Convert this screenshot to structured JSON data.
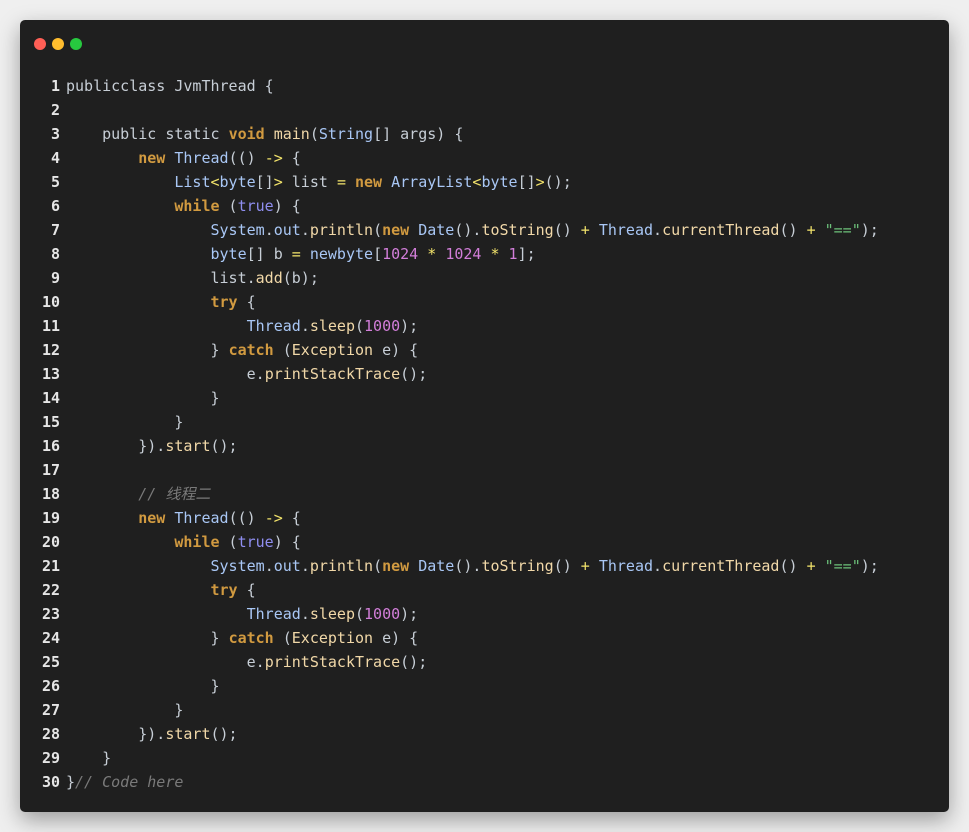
{
  "window": {
    "traffic_lights": [
      {
        "name": "close",
        "color": "#ff5f56"
      },
      {
        "name": "minimize",
        "color": "#ffbd2e"
      },
      {
        "name": "zoom",
        "color": "#27c93f"
      }
    ]
  },
  "code_lines": [
    {
      "n": "1",
      "tokens": [
        [
          "t-pl",
          "publicclass "
        ],
        [
          "t-pl",
          "JvmThread"
        ],
        [
          "t-pl",
          " {"
        ]
      ]
    },
    {
      "n": "2",
      "tokens": []
    },
    {
      "n": "3",
      "tokens": [
        [
          "t-pl",
          "    public static "
        ],
        [
          "t-kw",
          "void"
        ],
        [
          "t-pl",
          " "
        ],
        [
          "t-mth",
          "main"
        ],
        [
          "t-pl",
          "("
        ],
        [
          "t-cls",
          "String"
        ],
        [
          "t-pl",
          "[] args) {"
        ]
      ]
    },
    {
      "n": "4",
      "tokens": [
        [
          "t-pl",
          "        "
        ],
        [
          "t-kw",
          "new"
        ],
        [
          "t-pl",
          " "
        ],
        [
          "t-cls",
          "Thread"
        ],
        [
          "t-pl",
          "(() "
        ],
        [
          "t-op",
          "->"
        ],
        [
          "t-pl",
          " {"
        ]
      ]
    },
    {
      "n": "5",
      "tokens": [
        [
          "t-pl",
          "            "
        ],
        [
          "t-cls",
          "List"
        ],
        [
          "t-op",
          "<"
        ],
        [
          "t-cls",
          "byte"
        ],
        [
          "t-pl",
          "[]"
        ],
        [
          "t-op",
          ">"
        ],
        [
          "t-pl",
          " list "
        ],
        [
          "t-op",
          "="
        ],
        [
          "t-pl",
          " "
        ],
        [
          "t-kw",
          "new"
        ],
        [
          "t-pl",
          " "
        ],
        [
          "t-cls",
          "ArrayList"
        ],
        [
          "t-op",
          "<"
        ],
        [
          "t-cls",
          "byte"
        ],
        [
          "t-pl",
          "[]"
        ],
        [
          "t-op",
          ">"
        ],
        [
          "t-pl",
          "();"
        ]
      ]
    },
    {
      "n": "6",
      "tokens": [
        [
          "t-pl",
          "            "
        ],
        [
          "t-kw",
          "while"
        ],
        [
          "t-pl",
          " ("
        ],
        [
          "t-bool",
          "true"
        ],
        [
          "t-pl",
          ") {"
        ]
      ]
    },
    {
      "n": "7",
      "tokens": [
        [
          "t-pl",
          "                "
        ],
        [
          "t-cls",
          "System"
        ],
        [
          "t-pl",
          "."
        ],
        [
          "t-cls",
          "out"
        ],
        [
          "t-pl",
          "."
        ],
        [
          "t-mth",
          "println"
        ],
        [
          "t-pl",
          "("
        ],
        [
          "t-kw",
          "new"
        ],
        [
          "t-pl",
          " "
        ],
        [
          "t-cls",
          "Date"
        ],
        [
          "t-pl",
          "()."
        ],
        [
          "t-mth",
          "toString"
        ],
        [
          "t-pl",
          "() "
        ],
        [
          "t-op",
          "+"
        ],
        [
          "t-pl",
          " "
        ],
        [
          "t-cls",
          "Thread"
        ],
        [
          "t-pl",
          "."
        ],
        [
          "t-mth",
          "currentThread"
        ],
        [
          "t-pl",
          "() "
        ],
        [
          "t-op",
          "+"
        ],
        [
          "t-pl",
          " "
        ],
        [
          "t-str",
          "\"==\""
        ],
        [
          "t-pl",
          ");"
        ]
      ]
    },
    {
      "n": "8",
      "tokens": [
        [
          "t-pl",
          "                "
        ],
        [
          "t-cls",
          "byte"
        ],
        [
          "t-pl",
          "[] b "
        ],
        [
          "t-op",
          "="
        ],
        [
          "t-pl",
          " "
        ],
        [
          "t-cls",
          "newbyte"
        ],
        [
          "t-pl",
          "["
        ],
        [
          "t-num",
          "1024"
        ],
        [
          "t-pl",
          " "
        ],
        [
          "t-op",
          "*"
        ],
        [
          "t-pl",
          " "
        ],
        [
          "t-num",
          "1024"
        ],
        [
          "t-pl",
          " "
        ],
        [
          "t-op",
          "*"
        ],
        [
          "t-pl",
          " "
        ],
        [
          "t-num",
          "1"
        ],
        [
          "t-pl",
          "];"
        ]
      ]
    },
    {
      "n": "9",
      "tokens": [
        [
          "t-pl",
          "                list."
        ],
        [
          "t-mth",
          "add"
        ],
        [
          "t-pl",
          "(b);"
        ]
      ]
    },
    {
      "n": "10",
      "tokens": [
        [
          "t-pl",
          "                "
        ],
        [
          "t-kw",
          "try"
        ],
        [
          "t-pl",
          " {"
        ]
      ]
    },
    {
      "n": "11",
      "tokens": [
        [
          "t-pl",
          "                    "
        ],
        [
          "t-cls",
          "Thread"
        ],
        [
          "t-pl",
          "."
        ],
        [
          "t-mth",
          "sleep"
        ],
        [
          "t-pl",
          "("
        ],
        [
          "t-num",
          "1000"
        ],
        [
          "t-pl",
          ");"
        ]
      ]
    },
    {
      "n": "12",
      "tokens": [
        [
          "t-pl",
          "                } "
        ],
        [
          "t-kw",
          "catch"
        ],
        [
          "t-pl",
          " ("
        ],
        [
          "t-mth",
          "Exception"
        ],
        [
          "t-pl",
          " e) {"
        ]
      ]
    },
    {
      "n": "13",
      "tokens": [
        [
          "t-pl",
          "                    e."
        ],
        [
          "t-mth",
          "printStackTrace"
        ],
        [
          "t-pl",
          "();"
        ]
      ]
    },
    {
      "n": "14",
      "tokens": [
        [
          "t-pl",
          "                }"
        ]
      ]
    },
    {
      "n": "15",
      "tokens": [
        [
          "t-pl",
          "            }"
        ]
      ]
    },
    {
      "n": "16",
      "tokens": [
        [
          "t-pl",
          "        })."
        ],
        [
          "t-mth",
          "start"
        ],
        [
          "t-pl",
          "();"
        ]
      ]
    },
    {
      "n": "17",
      "tokens": []
    },
    {
      "n": "18",
      "tokens": [
        [
          "t-com",
          "        // 线程二"
        ]
      ]
    },
    {
      "n": "19",
      "tokens": [
        [
          "t-pl",
          "        "
        ],
        [
          "t-kw",
          "new"
        ],
        [
          "t-pl",
          " "
        ],
        [
          "t-cls",
          "Thread"
        ],
        [
          "t-pl",
          "(() "
        ],
        [
          "t-op",
          "->"
        ],
        [
          "t-pl",
          " {"
        ]
      ]
    },
    {
      "n": "20",
      "tokens": [
        [
          "t-pl",
          "            "
        ],
        [
          "t-kw",
          "while"
        ],
        [
          "t-pl",
          " ("
        ],
        [
          "t-bool",
          "true"
        ],
        [
          "t-pl",
          ") {"
        ]
      ]
    },
    {
      "n": "21",
      "tokens": [
        [
          "t-pl",
          "                "
        ],
        [
          "t-cls",
          "System"
        ],
        [
          "t-pl",
          "."
        ],
        [
          "t-cls",
          "out"
        ],
        [
          "t-pl",
          "."
        ],
        [
          "t-mth",
          "println"
        ],
        [
          "t-pl",
          "("
        ],
        [
          "t-kw",
          "new"
        ],
        [
          "t-pl",
          " "
        ],
        [
          "t-cls",
          "Date"
        ],
        [
          "t-pl",
          "()."
        ],
        [
          "t-mth",
          "toString"
        ],
        [
          "t-pl",
          "() "
        ],
        [
          "t-op",
          "+"
        ],
        [
          "t-pl",
          " "
        ],
        [
          "t-cls",
          "Thread"
        ],
        [
          "t-pl",
          "."
        ],
        [
          "t-mth",
          "currentThread"
        ],
        [
          "t-pl",
          "() "
        ],
        [
          "t-op",
          "+"
        ],
        [
          "t-pl",
          " "
        ],
        [
          "t-str",
          "\"==\""
        ],
        [
          "t-pl",
          ");"
        ]
      ]
    },
    {
      "n": "22",
      "tokens": [
        [
          "t-pl",
          "                "
        ],
        [
          "t-kw",
          "try"
        ],
        [
          "t-pl",
          " {"
        ]
      ]
    },
    {
      "n": "23",
      "tokens": [
        [
          "t-pl",
          "                    "
        ],
        [
          "t-cls",
          "Thread"
        ],
        [
          "t-pl",
          "."
        ],
        [
          "t-mth",
          "sleep"
        ],
        [
          "t-pl",
          "("
        ],
        [
          "t-num",
          "1000"
        ],
        [
          "t-pl",
          ");"
        ]
      ]
    },
    {
      "n": "24",
      "tokens": [
        [
          "t-pl",
          "                } "
        ],
        [
          "t-kw",
          "catch"
        ],
        [
          "t-pl",
          " ("
        ],
        [
          "t-mth",
          "Exception"
        ],
        [
          "t-pl",
          " e) {"
        ]
      ]
    },
    {
      "n": "25",
      "tokens": [
        [
          "t-pl",
          "                    e."
        ],
        [
          "t-mth",
          "printStackTrace"
        ],
        [
          "t-pl",
          "();"
        ]
      ]
    },
    {
      "n": "26",
      "tokens": [
        [
          "t-pl",
          "                }"
        ]
      ]
    },
    {
      "n": "27",
      "tokens": [
        [
          "t-pl",
          "            }"
        ]
      ]
    },
    {
      "n": "28",
      "tokens": [
        [
          "t-pl",
          "        })."
        ],
        [
          "t-mth",
          "start"
        ],
        [
          "t-pl",
          "();"
        ]
      ]
    },
    {
      "n": "29",
      "tokens": [
        [
          "t-pl",
          "    }"
        ]
      ]
    },
    {
      "n": "30",
      "tokens": [
        [
          "t-pl",
          "}"
        ],
        [
          "t-com",
          "// Code here"
        ]
      ]
    }
  ]
}
